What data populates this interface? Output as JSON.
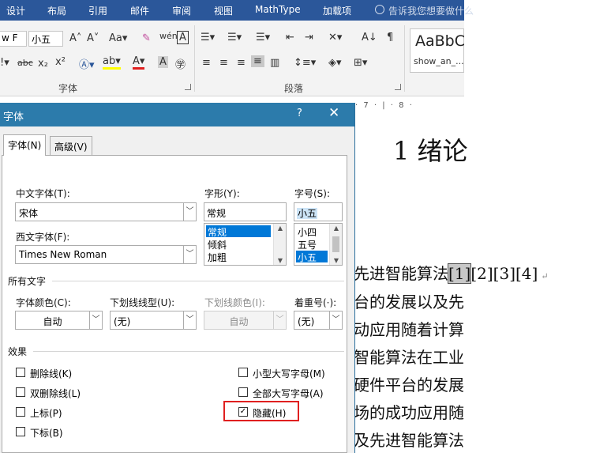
{
  "ribbon": {
    "tabs": [
      "设计",
      "布局",
      "引用",
      "邮件",
      "审阅",
      "视图",
      "MathType",
      "加载项"
    ],
    "tell_me": "告诉我您想要做什么",
    "font_name": "w F",
    "font_size": "小五",
    "group_font": "字体",
    "group_paragraph": "段落",
    "style_sample": "AaBbC",
    "style_name": "show_an_..."
  },
  "document": {
    "ruler": "· 7 · | · 8 ·",
    "heading": "1 绪论",
    "line1_text": "先进智能算法",
    "line1_cite": "[1]",
    "line1_rest": "[2][3][4]",
    "para_mark": "↵",
    "lines": [
      "台的发展以及先",
      "动应用随着计算",
      "智能算法在工业",
      "硬件平台的发展",
      "场的成功应用随",
      "及先进智能算法"
    ]
  },
  "dialog": {
    "title": "字体",
    "help": "?",
    "close": "✕",
    "tabs": [
      "字体(N)",
      "高级(V)"
    ],
    "chinese_font_label": "中文字体(T):",
    "chinese_font_value": "宋体",
    "western_font_label": "西文字体(F):",
    "western_font_value": "Times New Roman",
    "style_label": "字形(Y):",
    "style_value": "常规",
    "style_options": [
      "常规",
      "倾斜",
      "加粗"
    ],
    "size_label": "字号(S):",
    "size_value": "小五",
    "size_options": [
      "小四",
      "五号",
      "小五"
    ],
    "all_text_title": "所有文字",
    "font_color_label": "字体颜色(C):",
    "font_color_value": "自动",
    "underline_style_label": "下划线线型(U):",
    "underline_style_value": "(无)",
    "underline_color_label": "下划线颜色(I):",
    "underline_color_value": "自动",
    "emphasis_label": "着重号(·):",
    "emphasis_value": "(无)",
    "effects_title": "效果",
    "effects": {
      "strikethrough": "删除线(K)",
      "double_strikethrough": "双删除线(L)",
      "superscript": "上标(P)",
      "subscript": "下标(B)",
      "small_caps": "小型大写字母(M)",
      "all_caps": "全部大写字母(A)",
      "hidden": "隐藏(H)",
      "hidden_checked": true
    }
  }
}
